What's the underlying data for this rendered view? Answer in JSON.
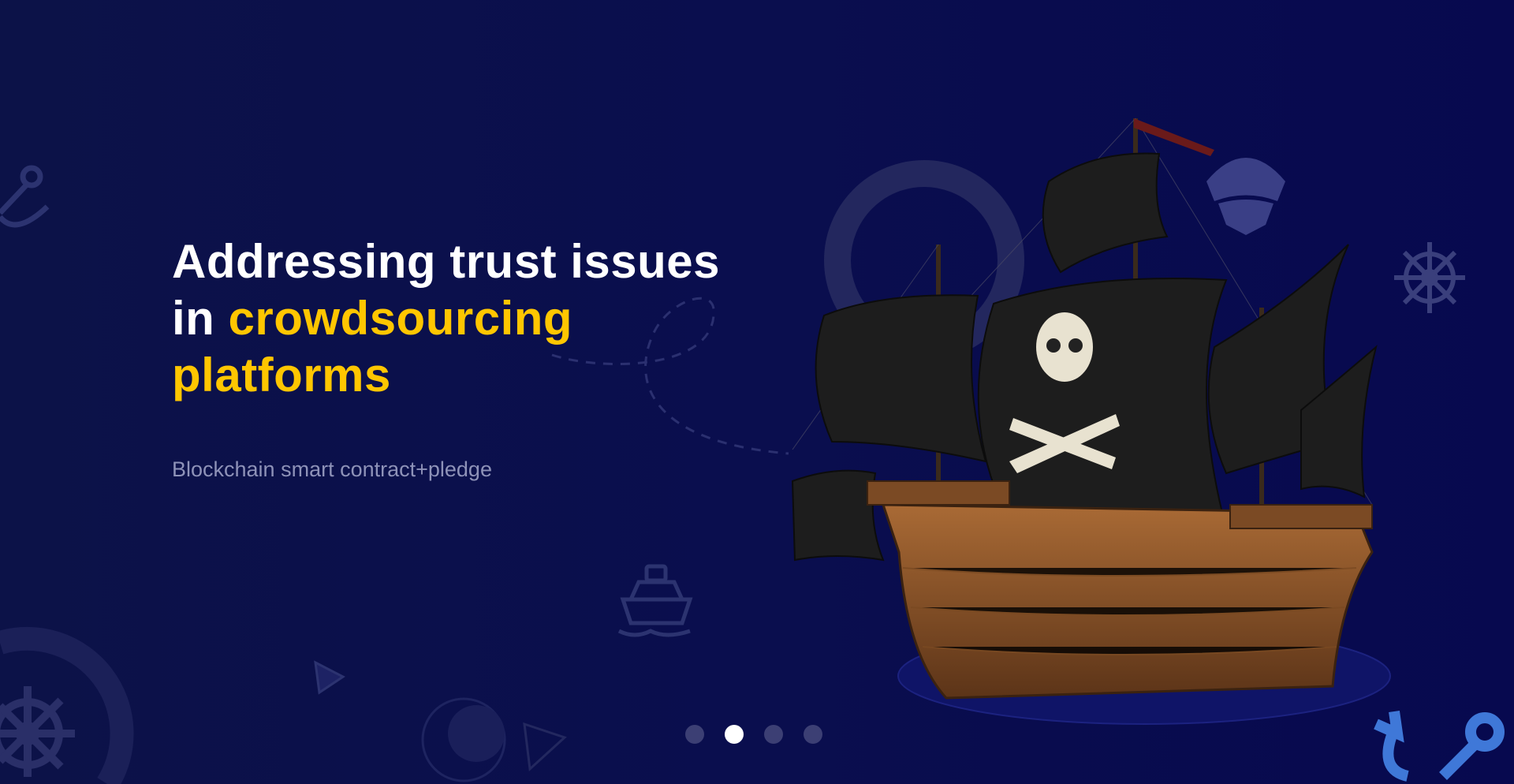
{
  "hero": {
    "title_line1": "Addressing trust issues",
    "title_line2_prefix": "in ",
    "title_line2_highlight": "crowdsourcing",
    "title_line3_highlight": "platforms",
    "subtitle": "Blockchain smart contract+pledge"
  },
  "carousel": {
    "slide_count": 4,
    "active_index": 1
  },
  "colors": {
    "background": "#0a0e4e",
    "highlight": "#ffc600",
    "subtitle": "#8e92b8",
    "accent_icon": "#3f78d8"
  },
  "decorations": [
    "anchor-icon",
    "ship-wheel-icon",
    "ship-icon",
    "pirate-logo-icon",
    "pirate-ship-illustration"
  ]
}
